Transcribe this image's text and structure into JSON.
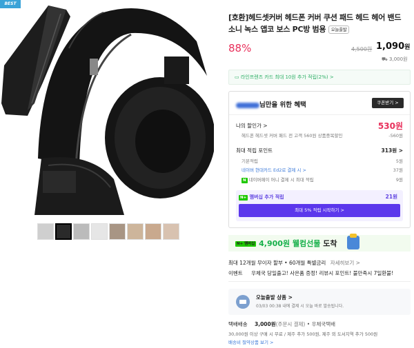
{
  "gallery": {
    "badge": "BEST",
    "thumbnail_count": 8
  },
  "product": {
    "title": "[호환]헤드셋커버 헤드폰 커버 쿠션 패드 헤드 헤어 밴드 소니 녹스 앱코 보스 PC방 범용",
    "today_badge": "오늘출발",
    "discount": "88%",
    "original_price": "4,500원",
    "price": "1,090",
    "price_unit": "원",
    "shipping_fee": "3,000원"
  },
  "card_promo": "라인프렌즈 카드 최대 10원 추가 적립(2%) >",
  "benefits": {
    "title_suffix": "님만을 위한 혜택",
    "coupon_button": "쿠폰받기 >",
    "my_discount_label": "나의 할인가 >",
    "my_discount_value": "530원",
    "my_discount_sub": "헤드폰 헤드셋 커버 패드 전 고객 560원 상품중복할인",
    "my_discount_sub_value": "-560원",
    "points_label": "최대 적립 포인트",
    "points_value": "313원 >",
    "basic_label": "기본적립",
    "basic_value": "5원",
    "hyundai_label": "네이버 현대카드 Ed2로 결제 시 >",
    "hyundai_value": "37원",
    "npay_label": "네이버페이 머니 결제 시 최대 적립",
    "npay_value": "9원",
    "npay_mark": "N",
    "membership_label": "멤버십 추가 적립",
    "membership_value": "21원",
    "membership_mark": "N+",
    "membership_button": "최대 5% 적립 시작하기 >"
  },
  "gift": {
    "tag": "N+ 멤버십",
    "amount": "4,900원 웰컴선물",
    "suffix": " 도착"
  },
  "installment": {
    "text": "최대 12개월 무이자 할부 • 60개월 특별금리",
    "link": "자세히보기 >"
  },
  "event": {
    "label": "이벤트",
    "text": "우체국 당일출고! 사은품 증정! 리뷰시 포인트! 불만족시 7일환불!"
  },
  "today_shipping": {
    "title": "오늘출발 상품 >",
    "sub": "03/03 00:38 내에 결제 시 오늘 바로 발송됩니다."
  },
  "delivery": {
    "label": "택배배송",
    "fee": "3,000원",
    "fee_note": "(주문시 결제)",
    "carrier": "• 우체국택배",
    "extra": "30,000원 이상 구매 시 무료 / 제주 추가 500원, 제주 외 도서지역 추가 500원",
    "bundle_link": "배송비 절약상품 보기 >"
  }
}
